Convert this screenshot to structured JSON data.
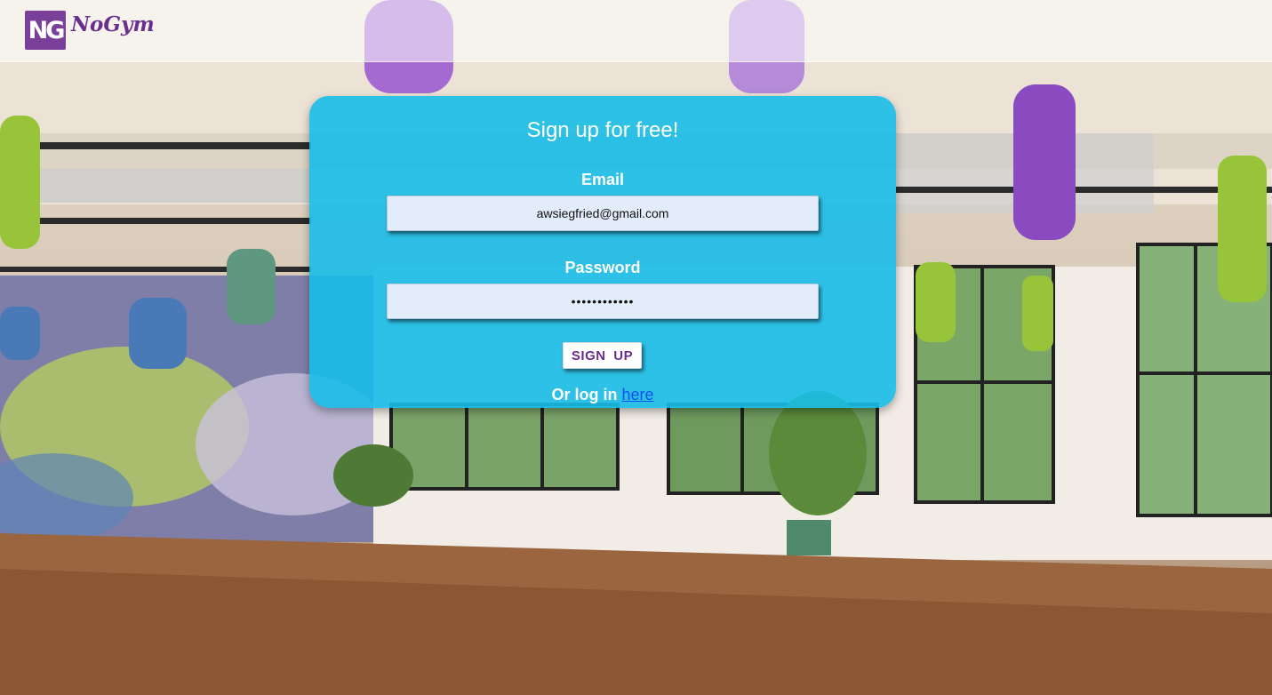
{
  "header": {
    "logo_mark": "NG",
    "logo_text": "NoGym"
  },
  "signup": {
    "title": "Sign up for free!",
    "email_label": "Email",
    "email_value": "awsiegfried@gmail.com",
    "password_label": "Password",
    "password_value": "••••••••••••",
    "submit_label": "SIGN UP",
    "login_prefix": "Or log in",
    "login_link": "here"
  },
  "colors": {
    "card_background": "#18bce8",
    "brand_purple": "#6a2f8e",
    "link_blue": "#0a52e8"
  },
  "icons": {
    "logo": "ng-logo-icon"
  }
}
